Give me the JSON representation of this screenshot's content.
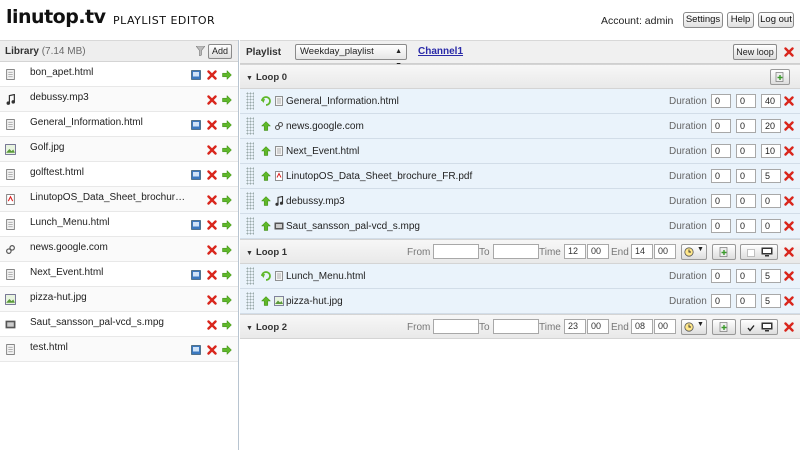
{
  "header": {
    "logo": "linutop.tv",
    "app_title": "PLAYLIST EDITOR",
    "account_label": "Account: admin",
    "buttons": {
      "settings": "Settings",
      "help": "Help",
      "logout": "Log out"
    }
  },
  "library": {
    "title": "Library",
    "size": "(7.14 MB)",
    "add_label": "Add",
    "items": [
      {
        "name": "bon_apet.html",
        "type": "html-icon"
      },
      {
        "name": "debussy.mp3",
        "type": "music-icon"
      },
      {
        "name": "General_Information.html",
        "type": "html-icon"
      },
      {
        "name": "Golf.jpg",
        "type": "image-icon"
      },
      {
        "name": "golftest.html",
        "type": "html-icon"
      },
      {
        "name": "LinutopOS_Data_Sheet_brochure_FR.pdf",
        "type": "pdf-icon"
      },
      {
        "name": "Lunch_Menu.html",
        "type": "html-icon"
      },
      {
        "name": "news.google.com",
        "type": "link-icon"
      },
      {
        "name": "Next_Event.html",
        "type": "html-icon"
      },
      {
        "name": "pizza-hut.jpg",
        "type": "image-icon"
      },
      {
        "name": "Saut_sansson_pal-vcd_s.mpg",
        "type": "video-icon"
      },
      {
        "name": "test.html",
        "type": "html-icon"
      }
    ]
  },
  "playlist": {
    "label": "Playlist",
    "selected": "Weekday_playlist",
    "channel": "Channel1",
    "new_loop_label": "New loop",
    "duration_label": "Duration",
    "from_label": "From",
    "to_label": "To",
    "time_label": "Time",
    "end_label": "End",
    "loops": [
      {
        "title": "Loop 0",
        "items": [
          {
            "name": "General_Information.html",
            "h": "0",
            "m": "0",
            "s": "40"
          },
          {
            "name": "news.google.com",
            "h": "0",
            "m": "0",
            "s": "20"
          },
          {
            "name": "Next_Event.html",
            "h": "0",
            "m": "0",
            "s": "10"
          },
          {
            "name": "LinutopOS_Data_Sheet_brochure_FR.pdf",
            "h": "0",
            "m": "0",
            "s": "5"
          },
          {
            "name": "debussy.mp3",
            "h": "0",
            "m": "0",
            "s": "0"
          },
          {
            "name": "Saut_sansson_pal-vcd_s.mpg",
            "h": "0",
            "m": "0",
            "s": "0"
          }
        ]
      },
      {
        "title": "Loop 1",
        "from": "",
        "to": "",
        "time_h": "12",
        "time_m": "00",
        "end_h": "14",
        "end_m": "00",
        "items": [
          {
            "name": "Lunch_Menu.html",
            "h": "0",
            "m": "0",
            "s": "5"
          },
          {
            "name": "pizza-hut.jpg",
            "h": "0",
            "m": "0",
            "s": "5"
          }
        ]
      },
      {
        "title": "Loop 2",
        "from": "",
        "to": "",
        "time_h": "23",
        "time_m": "00",
        "end_h": "08",
        "end_m": "00",
        "items": []
      }
    ]
  },
  "colors": {
    "delete": "#d9261c",
    "play": "#5fb82a",
    "link": "#2a2aa8",
    "row_bg": "#eaf3fb"
  }
}
